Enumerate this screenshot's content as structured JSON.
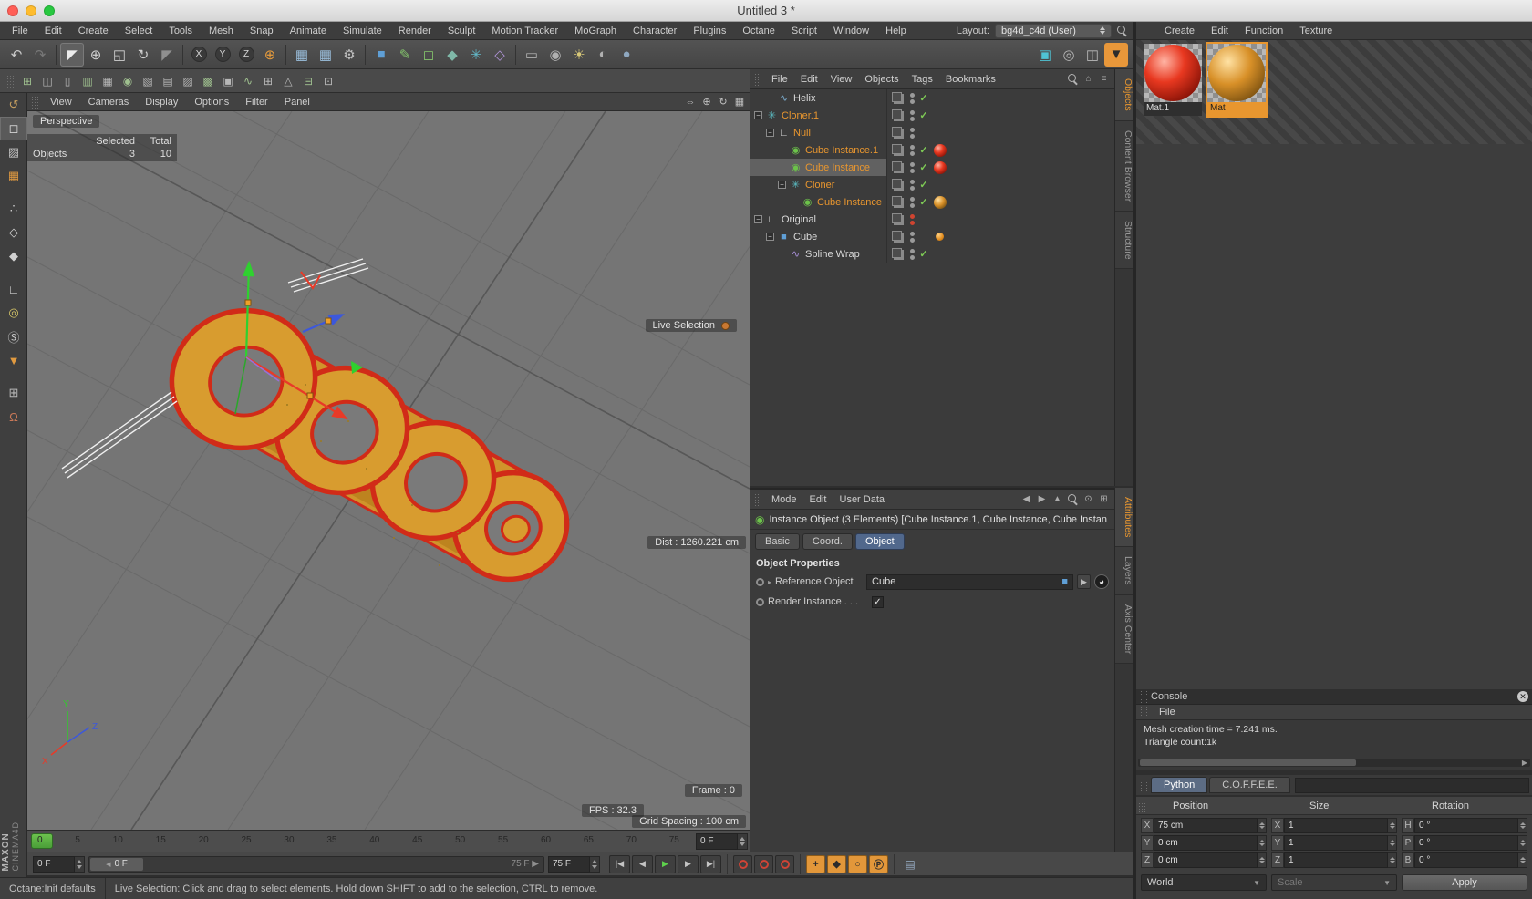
{
  "window": {
    "title": "Untitled 3 *"
  },
  "menubar": {
    "items": [
      "File",
      "Edit",
      "Create",
      "Select",
      "Tools",
      "Mesh",
      "Snap",
      "Animate",
      "Simulate",
      "Render",
      "Sculpt",
      "Motion Tracker",
      "MoGraph",
      "Character",
      "Plugins",
      "Octane",
      "Script",
      "Window",
      "Help"
    ],
    "layout_label": "Layout:",
    "layout_value": "bg4d_c4d (User)"
  },
  "material_panel": {
    "menus": [
      "Create",
      "Edit",
      "Function",
      "Texture"
    ],
    "materials": [
      {
        "name": "Mat.1",
        "selected": false
      },
      {
        "name": "Mat",
        "selected": true
      }
    ]
  },
  "toolbar_main": [
    {
      "name": "undo-icon",
      "glyph": "↶",
      "color": "#c8c8c8"
    },
    {
      "name": "redo-icon",
      "glyph": "↷",
      "color": "#787878"
    },
    {
      "sep": true
    },
    {
      "name": "live-selection-icon",
      "glyph": "◤",
      "color": "#ececec",
      "active": true
    },
    {
      "name": "move-icon",
      "glyph": "⊕",
      "color": "#d0d0d0"
    },
    {
      "name": "scale-icon",
      "glyph": "◱",
      "color": "#d0d0d0"
    },
    {
      "name": "rotate-icon",
      "glyph": "↻",
      "color": "#d0d0d0"
    },
    {
      "name": "last-tool-icon",
      "glyph": "◤",
      "color": "#8f8f8f"
    },
    {
      "sep": true
    },
    {
      "name": "lock-x-axis-icon",
      "glyph": "X",
      "color": "#d8d8d8",
      "round": true
    },
    {
      "name": "lock-y-axis-icon",
      "glyph": "Y",
      "color": "#d8d8d8",
      "round": true
    },
    {
      "name": "lock-z-axis-icon",
      "glyph": "Z",
      "color": "#d8d8d8",
      "round": true
    },
    {
      "name": "coordinate-system-icon",
      "glyph": "⊕",
      "color": "#e89c3c"
    },
    {
      "sep": true
    },
    {
      "name": "render-view-icon",
      "glyph": "▦",
      "color": "#9cc0de"
    },
    {
      "name": "render-picture-viewer-icon",
      "glyph": "▦",
      "color": "#9cc0de"
    },
    {
      "name": "render-settings-icon",
      "glyph": "⚙",
      "color": "#c0c0c0"
    },
    {
      "sep": true
    },
    {
      "name": "add-cube-icon",
      "glyph": "■",
      "color": "#5f9fd6"
    },
    {
      "name": "add-spline-pen-icon",
      "glyph": "✎",
      "color": "#84c46c"
    },
    {
      "name": "subdivision-surface-icon",
      "glyph": "◻",
      "color": "#84c46c"
    },
    {
      "name": "extrude-generator-icon",
      "glyph": "◆",
      "color": "#7fb8a8"
    },
    {
      "name": "mograph-cloner-icon",
      "glyph": "✳",
      "color": "#62b8c8"
    },
    {
      "name": "deformer-icon",
      "glyph": "◇",
      "color": "#b094d8"
    },
    {
      "sep": true
    },
    {
      "name": "floor-icon",
      "glyph": "▭",
      "color": "#b0b0b0"
    },
    {
      "name": "camera-icon",
      "glyph": "◉",
      "color": "#b0b0b0"
    },
    {
      "name": "light-icon",
      "glyph": "☀",
      "color": "#d8c878"
    },
    {
      "name": "sky-icon",
      "glyph": "◐",
      "color": "#b0b0b0"
    },
    {
      "name": "environment-icon",
      "glyph": "●",
      "color": "#8fa8c0"
    }
  ],
  "toolbar_right": [
    {
      "name": "interactive-render-region-icon",
      "glyph": "▣",
      "color": "#4fc3d4"
    },
    {
      "name": "snapshot-icon",
      "glyph": "◎",
      "color": "#b8b8b8"
    },
    {
      "name": "team-render-icon",
      "glyph": "◫",
      "color": "#b8b8b8"
    },
    {
      "name": "save-scene-icon",
      "glyph": "▼",
      "color": "#2c2c2c",
      "bg": "#e8973a"
    }
  ],
  "toolbar_modeling": [
    {
      "name": "array-tool-icon",
      "glyph": "⊞",
      "color": "#9fc08f"
    },
    {
      "name": "boole-tool-icon",
      "glyph": "◫",
      "color": "#b8b8b8"
    },
    {
      "name": "symmetry-tool-icon",
      "glyph": "▯",
      "color": "#b8b8b8"
    },
    {
      "name": "connect-tool-icon",
      "glyph": "▥",
      "color": "#9fc08f"
    },
    {
      "name": "instance-tool-icon",
      "glyph": "▦",
      "color": "#b8b8b8"
    },
    {
      "name": "metaball-tool-icon",
      "glyph": "◉",
      "color": "#9fc08f"
    },
    {
      "name": "extrude-nurbs-icon",
      "glyph": "▧",
      "color": "#b8b8b8"
    },
    {
      "name": "lathe-nurbs-icon",
      "glyph": "▤",
      "color": "#b8b8b8"
    },
    {
      "name": "loft-nurbs-icon",
      "glyph": "▨",
      "color": "#b8b8b8"
    },
    {
      "name": "sweep-nurbs-icon",
      "glyph": "▩",
      "color": "#9fc08f"
    },
    {
      "name": "bezier-nurbs-icon",
      "glyph": "▣",
      "color": "#b8b8b8"
    },
    {
      "name": "spline-tools-icon",
      "glyph": "∿",
      "color": "#9fc08f"
    },
    {
      "name": "subdivide-icon",
      "glyph": "⊞",
      "color": "#b8b8b8"
    },
    {
      "name": "weight-tool-icon",
      "glyph": "△",
      "color": "#b8b8b8"
    },
    {
      "name": "ffd-icon",
      "glyph": "⊟",
      "color": "#9fc08f"
    },
    {
      "name": "correction-deformer-icon",
      "glyph": "⊡",
      "color": "#b8b8b8"
    }
  ],
  "sidebar_tools": [
    {
      "name": "make-editable-icon",
      "glyph": "↺",
      "color": "#c8a060"
    },
    {
      "name": "model-mode-icon",
      "glyph": "◻",
      "color": "#e2e2e2",
      "active": true
    },
    {
      "name": "texture-mode-icon",
      "glyph": "▨",
      "color": "#c0c0c0"
    },
    {
      "name": "workplane-mode-icon",
      "glyph": "▦",
      "color": "#e09a40"
    },
    {
      "gap": true
    },
    {
      "name": "points-mode-icon",
      "glyph": "∴",
      "color": "#d0d0d0"
    },
    {
      "name": "edges-mode-icon",
      "glyph": "◇",
      "color": "#d0d0d0"
    },
    {
      "name": "polygons-mode-icon",
      "glyph": "◆",
      "color": "#d0d0d0"
    },
    {
      "gap": true
    },
    {
      "name": "enable-axis-icon",
      "glyph": "∟",
      "color": "#d0d0d0"
    },
    {
      "name": "viewport-solo-icon",
      "glyph": "◎",
      "color": "#d8c868"
    },
    {
      "name": "snap-icon",
      "glyph": "Ⓢ",
      "color": "#d0d0d0"
    },
    {
      "name": "paint-bucket-icon",
      "glyph": "▼",
      "color": "#e09a40"
    },
    {
      "gap": true
    },
    {
      "name": "workplane-lock-icon",
      "glyph": "⊞",
      "color": "#b8b8b8"
    },
    {
      "name": "snap-magnet-icon",
      "glyph": "Ω",
      "color": "#c87858"
    }
  ],
  "viewport": {
    "menus": [
      "View",
      "Cameras",
      "Display",
      "Options",
      "Filter",
      "Panel"
    ],
    "controls": [
      {
        "name": "pan-view-icon",
        "glyph": "⇔"
      },
      {
        "name": "dolly-view-icon",
        "glyph": "⊕"
      },
      {
        "name": "rotate-view-icon",
        "glyph": "↻"
      },
      {
        "name": "toggle-views-icon",
        "glyph": "▦"
      }
    ],
    "camera_label": "Perspective",
    "hud": {
      "selected_header": "Selected",
      "total_header": "Total",
      "objects_label": "Objects",
      "objects_selected": "3",
      "objects_total": "10",
      "live_selection": "Live Selection",
      "distance": "Dist : 1260.221 cm",
      "frame": "Frame : 0",
      "fps": "FPS : 32.3",
      "grid_spacing": "Grid Spacing : 100 cm"
    }
  },
  "object_manager": {
    "menus": [
      "File",
      "Edit",
      "View",
      "Objects",
      "Tags",
      "Bookmarks"
    ],
    "header_icons": [
      {
        "name": "search-icon",
        "mag": true
      },
      {
        "name": "home-icon",
        "glyph": "⌂"
      },
      {
        "name": "filter-icon",
        "glyph": "≡"
      }
    ],
    "side_tabs": [
      {
        "label": "Objects",
        "active": true
      },
      {
        "label": "Content Browser"
      },
      {
        "label": "Structure"
      }
    ],
    "rows": [
      {
        "label": "Helix",
        "level": 1,
        "orange": false,
        "selected": false,
        "expander": false,
        "icon": "helix",
        "dots": "gray",
        "check": true,
        "material": ""
      },
      {
        "label": "Cloner.1",
        "level": 0,
        "orange": true,
        "selected": false,
        "expander": true,
        "icon": "cloner",
        "dots": "gray",
        "check": true,
        "material": ""
      },
      {
        "label": "Null",
        "level": 1,
        "orange": true,
        "selected": false,
        "expander": true,
        "icon": "null",
        "dots": "gray",
        "check": false,
        "material": ""
      },
      {
        "label": "Cube Instance.1",
        "level": 2,
        "orange": true,
        "selected": false,
        "expander": false,
        "icon": "instance",
        "dots": "gray",
        "check": true,
        "material": "red"
      },
      {
        "label": "Cube Instance",
        "level": 2,
        "orange": true,
        "selected": true,
        "expander": false,
        "icon": "instance",
        "dots": "gray",
        "check": true,
        "material": "red"
      },
      {
        "label": "Cloner",
        "level": 2,
        "orange": true,
        "selected": false,
        "expander": true,
        "icon": "cloner",
        "dots": "gray",
        "check": true,
        "material": ""
      },
      {
        "label": "Cube Instance",
        "level": 3,
        "orange": true,
        "selected": false,
        "expander": false,
        "icon": "instance",
        "dots": "gray",
        "check": true,
        "material": "gold"
      },
      {
        "label": "Original",
        "level": 0,
        "orange": false,
        "selected": false,
        "expander": true,
        "icon": "null",
        "dots": "red",
        "check": false,
        "material": ""
      },
      {
        "label": "Cube",
        "level": 1,
        "orange": false,
        "selected": false,
        "expander": true,
        "icon": "cube",
        "dots": "gray",
        "check": false,
        "material": "dot"
      },
      {
        "label": "Spline Wrap",
        "level": 2,
        "orange": false,
        "selected": false,
        "expander": false,
        "icon": "splinewrap",
        "dots": "gray",
        "check": true,
        "material": ""
      }
    ]
  },
  "attribute_manager": {
    "menus": [
      "Mode",
      "Edit",
      "User Data"
    ],
    "header_icons": [
      {
        "name": "history-back-icon",
        "glyph": "◀"
      },
      {
        "name": "history-forward-icon",
        "glyph": "▶"
      },
      {
        "name": "parent-object-icon",
        "glyph": "▲"
      },
      {
        "name": "search-icon",
        "mag": true
      },
      {
        "name": "lock-icon",
        "glyph": "⊙"
      },
      {
        "name": "new-panel-icon",
        "glyph": "⊞"
      }
    ],
    "side_tabs": [
      {
        "label": "Attributes",
        "active": true
      },
      {
        "label": "Layers"
      },
      {
        "label": "Axis Center"
      }
    ],
    "object_title": "Instance Object (3 Elements) [Cube Instance.1, Cube Instance, Cube Instan",
    "tabs": [
      {
        "label": "Basic"
      },
      {
        "label": "Coord."
      },
      {
        "label": "Object",
        "active": true
      }
    ],
    "section_title": "Object Properties",
    "reference_label": "Reference Object",
    "reference_value": "Cube",
    "render_instance_label": "Render Instance . . ."
  },
  "console": {
    "title": "Console",
    "menu": "File",
    "lines": [
      "Mesh creation time = 7.241 ms.",
      "Triangle count:1k"
    ]
  },
  "script_tabs": [
    {
      "label": "Python",
      "active": true
    },
    {
      "label": "C.O.F.F.E.E."
    }
  ],
  "coordinates": {
    "headers": [
      "Position",
      "Size",
      "Rotation"
    ],
    "groups": [
      [
        {
          "l": "X",
          "v": "75 cm"
        },
        {
          "l": "Y",
          "v": "0 cm"
        },
        {
          "l": "Z",
          "v": "0 cm"
        }
      ],
      [
        {
          "l": "X",
          "v": "1"
        },
        {
          "l": "Y",
          "v": "1"
        },
        {
          "l": "Z",
          "v": "1"
        }
      ],
      [
        {
          "l": "H",
          "v": "0 °"
        },
        {
          "l": "P",
          "v": "0 °"
        },
        {
          "l": "B",
          "v": "0 °"
        }
      ]
    ],
    "space": "World",
    "mode": "Scale",
    "apply": "Apply"
  },
  "timeline": {
    "ticks": [
      "0",
      "5",
      "10",
      "15",
      "20",
      "25",
      "30",
      "35",
      "40",
      "45",
      "50",
      "55",
      "60",
      "65",
      "70",
      "75"
    ],
    "ruler_frame": "0 F",
    "current": "0 F",
    "range_start": "0 F",
    "range_end": "75 F",
    "end": "75 F",
    "transport": [
      {
        "name": "goto-start-button",
        "glyph": "|◀"
      },
      {
        "name": "previous-frame-button",
        "glyph": "◀"
      },
      {
        "name": "play-button",
        "glyph": "▶",
        "color": "#5ed14c"
      },
      {
        "name": "next-frame-button",
        "glyph": "▶"
      },
      {
        "name": "goto-end-button",
        "glyph": "▶|"
      }
    ],
    "record_buttons": [
      {
        "name": "record-position-button"
      },
      {
        "name": "record-scale-button"
      },
      {
        "name": "record-rotation-button"
      }
    ],
    "key_buttons": [
      {
        "name": "record-active-objects-button",
        "glyph": "+"
      },
      {
        "name": "autokeying-button",
        "glyph": "◆"
      },
      {
        "name": "keyframe-selection-button",
        "glyph": "○"
      },
      {
        "name": "keyframe-parameter-button",
        "glyph": "Ⓟ"
      }
    ]
  },
  "statusbar": {
    "left": "Octane:Init defaults",
    "right": "Live Selection: Click and drag to select elements. Hold down SHIFT to add to the selection, CTRL to remove."
  },
  "branding": {
    "maxon": "MAXON",
    "product": "CINEMA4D"
  }
}
